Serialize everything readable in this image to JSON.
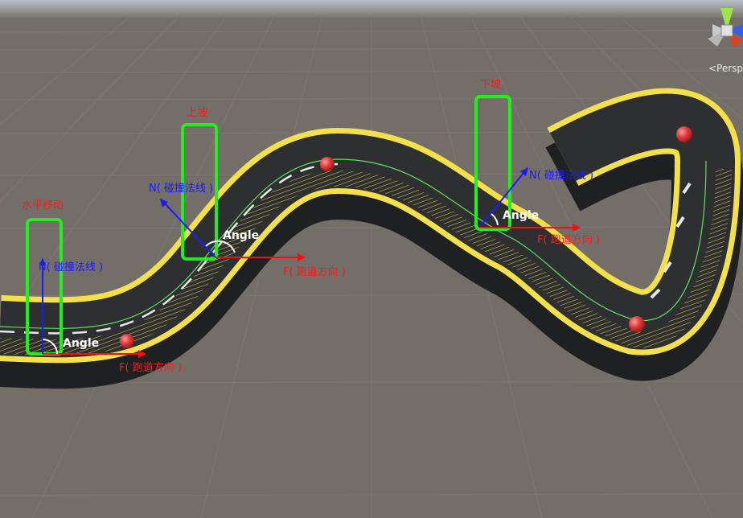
{
  "view": {
    "projection_label": "<Persp"
  },
  "sections": [
    {
      "title": "水平移动",
      "normal_label": "N( 碰撞法线 )",
      "angle_label": "Angle",
      "forward_label": "F( 跑道方向 )"
    },
    {
      "title": "上坡",
      "normal_label": "N( 碰撞法线 )",
      "angle_label": "Angle",
      "forward_label": "F( 跑道方向 )"
    },
    {
      "title": "下坡",
      "normal_label": "N( 碰撞法线 )",
      "angle_label": "Angle",
      "forward_label": "F( 跑道方向 )"
    }
  ],
  "colors": {
    "ground": "#736e68",
    "track": "#2e2f31",
    "track_edge": "#f3e04a",
    "highlight_box": "#22ee22",
    "normal_arrow": "#1a1aff",
    "forward_arrow": "#ee1111"
  }
}
